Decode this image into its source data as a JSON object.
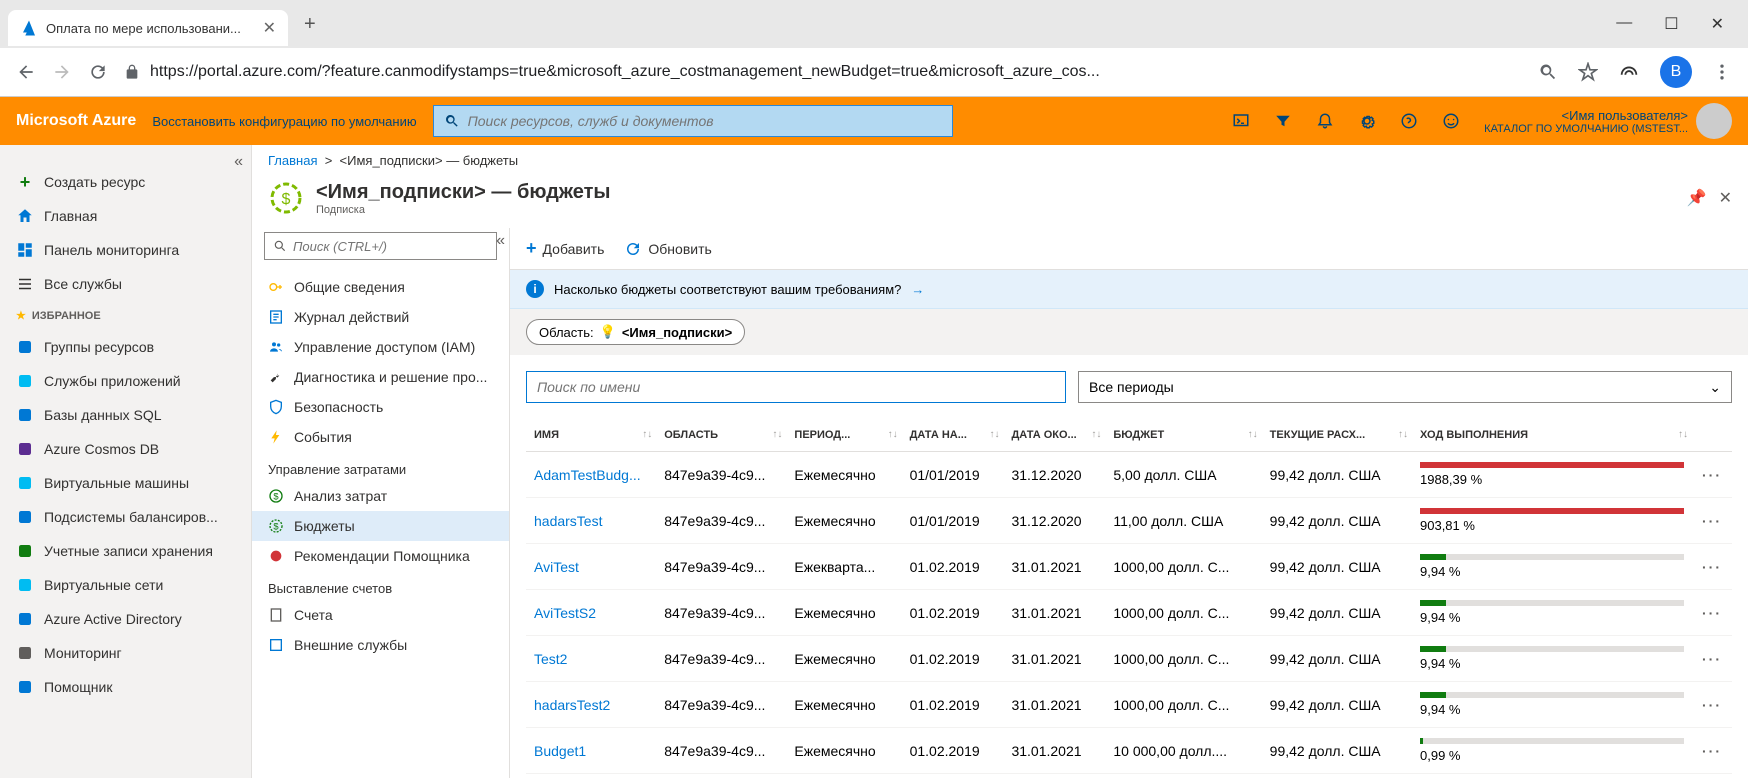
{
  "browser": {
    "tab_title": "Оплата по мере использовани...",
    "url": "https://portal.azure.com/?feature.canmodifystamps=true&microsoft_azure_costmanagement_newBudget=true&microsoft_azure_cos...",
    "user_initial": "В"
  },
  "azure_header": {
    "logo": "Microsoft Azure",
    "restore": "Восстановить конфигурацию по умолчанию",
    "search_placeholder": "Поиск ресурсов, служб и документов",
    "user_name": "<Имя пользователя>",
    "user_directory": "КАТАЛОГ ПО УМОЛЧАНИЮ (MSTEST..."
  },
  "sidebar_left": {
    "create": "Создать ресурс",
    "home": "Главная",
    "dashboard": "Панель мониторинга",
    "all_services": "Все службы",
    "favorites_label": "ИЗБРАННОЕ",
    "items": [
      "Группы ресурсов",
      "Службы приложений",
      "Базы данных SQL",
      "Azure Cosmos DB",
      "Виртуальные машины",
      "Подсистемы балансиров...",
      "Учетные записи хранения",
      "Виртуальные сети",
      "Azure Active Directory",
      "Мониторинг",
      "Помощник"
    ]
  },
  "breadcrumb": {
    "home": "Главная",
    "current": "<Имя_подписки> — бюджеты"
  },
  "page": {
    "title": "<Имя_подписки> — бюджеты",
    "subtitle": "Подписка"
  },
  "sidebar_mid": {
    "search_placeholder": "Поиск (CTRL+/)",
    "overview": "Общие сведения",
    "activity": "Журнал действий",
    "iam": "Управление доступом (IAM)",
    "diagnose": "Диагностика и решение про...",
    "security": "Безопасность",
    "events": "События",
    "cost_section": "Управление затратами",
    "cost_analysis": "Анализ затрат",
    "budgets": "Бюджеты",
    "recommendations": "Рекомендации Помощника",
    "billing_section": "Выставление счетов",
    "invoices": "Счета",
    "external": "Внешние службы"
  },
  "toolbar": {
    "add": "Добавить",
    "refresh": "Обновить"
  },
  "banner": {
    "text": "Насколько бюджеты соответствуют вашим требованиям?"
  },
  "scope": {
    "label": "Область:",
    "value": "<Имя_подписки>"
  },
  "filters": {
    "search_placeholder": "Поиск по имени",
    "period": "Все периоды"
  },
  "table": {
    "headers": {
      "name": "ИМЯ",
      "scope": "ОБЛАСТЬ",
      "period": "ПЕРИОД...",
      "start": "ДАТА НА...",
      "end": "ДАТА ОКО...",
      "budget": "БЮДЖЕТ",
      "current": "ТЕКУЩИЕ РАСХ...",
      "progress": "ХОД ВЫПОЛНЕНИЯ"
    },
    "rows": [
      {
        "name": "AdamTestBudg...",
        "scope": "847e9a39-4c9...",
        "period": "Ежемесячно",
        "start": "01/01/2019",
        "end": "31.12.2020",
        "budget": "5,00 долл. США",
        "current": "99,42 долл. США",
        "progress": "1988,39 %",
        "over": true
      },
      {
        "name": "hadarsTest",
        "scope": "847e9a39-4c9...",
        "period": "Ежемесячно",
        "start": "01/01/2019",
        "end": "31.12.2020",
        "budget": "11,00 долл. США",
        "current": "99,42 долл. США",
        "progress": "903,81 %",
        "over": true
      },
      {
        "name": "AviTest",
        "scope": "847e9a39-4c9...",
        "period": "Ежекварта...",
        "start": "01.02.2019",
        "end": "31.01.2021",
        "budget": "1000,00 долл. С...",
        "current": "99,42 долл. США",
        "progress": "9,94 %",
        "over": false,
        "pct": 9.94
      },
      {
        "name": "AviTestS2",
        "scope": "847e9a39-4c9...",
        "period": "Ежемесячно",
        "start": "01.02.2019",
        "end": "31.01.2021",
        "budget": "1000,00 долл. С...",
        "current": "99,42 долл. США",
        "progress": "9,94 %",
        "over": false,
        "pct": 9.94
      },
      {
        "name": "Test2",
        "scope": "847e9a39-4c9...",
        "period": "Ежемесячно",
        "start": "01.02.2019",
        "end": "31.01.2021",
        "budget": "1000,00 долл. С...",
        "current": "99,42 долл. США",
        "progress": "9,94 %",
        "over": false,
        "pct": 9.94
      },
      {
        "name": "hadarsTest2",
        "scope": "847e9a39-4c9...",
        "period": "Ежемесячно",
        "start": "01.02.2019",
        "end": "31.01.2021",
        "budget": "1000,00 долл. С...",
        "current": "99,42 долл. США",
        "progress": "9,94 %",
        "over": false,
        "pct": 9.94
      },
      {
        "name": "Budget1",
        "scope": "847e9a39-4c9...",
        "period": "Ежемесячно",
        "start": "01.02.2019",
        "end": "31.01.2021",
        "budget": "10 000,00 долл....",
        "current": "99,42 долл. США",
        "progress": "0,99 %",
        "over": false,
        "pct": 0.99
      }
    ]
  }
}
